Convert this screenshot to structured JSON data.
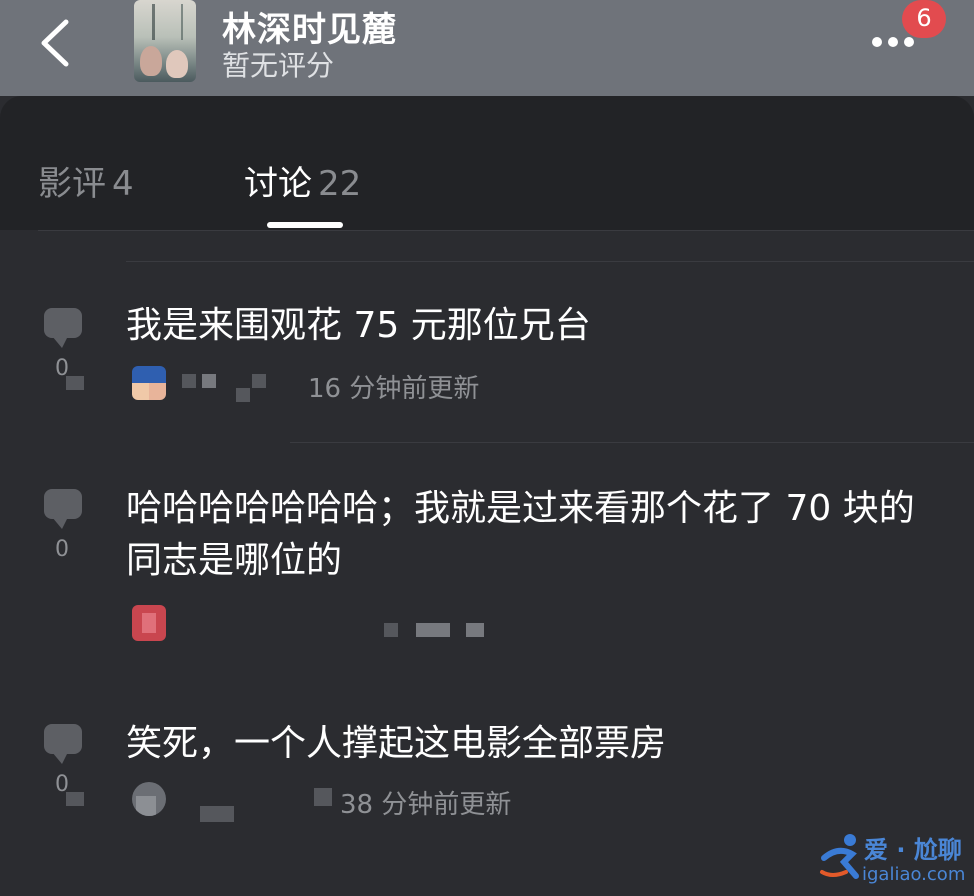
{
  "header": {
    "title": "林深时见麓",
    "rating": "暂无评分",
    "notification_count": "6"
  },
  "tabs": [
    {
      "label": "影评",
      "count": "4"
    },
    {
      "label": "讨论",
      "count": "22"
    }
  ],
  "discussions": [
    {
      "text": "我是来围观花 75 元那位兄台",
      "comment_count": "0",
      "updated": "16 分钟前更新"
    },
    {
      "text": "哈哈哈哈哈哈哈；我就是过来看那个花了 70 块的同志是哪位的",
      "comment_count": "0",
      "updated": ""
    },
    {
      "text": "笑死，一个人撑起这电影全部票房",
      "comment_count": "0",
      "updated": "38 分钟前更新"
    }
  ],
  "watermark": {
    "text": "爱 · 尬聊",
    "url": "igaliao.com"
  },
  "colors": {
    "header_bg": "#6f737a",
    "page_bg": "#2b2c30",
    "tabs_bg": "#222326",
    "badge": "#e24b4f"
  }
}
